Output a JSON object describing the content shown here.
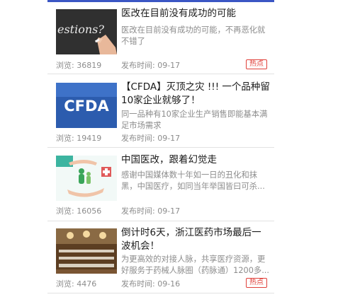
{
  "labels": {
    "views": "浏览: ",
    "published": "发布时间: "
  },
  "articles": [
    {
      "title": "医改在目前没有成功的可能",
      "summary": "医改在目前没有成功的可能，不再恶化就不错了",
      "views": "36819",
      "date": "09-17",
      "badge": "热点",
      "thumb_text": "estions?",
      "thumb_icon": "chalkboard-hand-image"
    },
    {
      "title": "【CFDA】灭顶之灾 !!! 一个品种留10家企业就够了！",
      "summary": "同一品种有10家企业生产销售即能基本满足市场需求",
      "views": "19419",
      "date": "09-17",
      "badge": "",
      "thumb_text": "CFDA",
      "thumb_icon": "cfda-logo-image"
    },
    {
      "title": "中国医改，跟着幻觉走",
      "summary": "感谢中国媒体数十年如一日的丑化和抹黑，中国医疗，如同当年举国皆曰可杀...",
      "views": "16056",
      "date": "09-17",
      "badge": "",
      "thumb_text": "",
      "thumb_icon": "family-care-image"
    },
    {
      "title": "倒计时6天，浙江医药市场最后一波机会！",
      "summary": "为更高效的对接人脉，共享医疗资源，更好服务于药械人脉圈（药脉通）1200多...",
      "views": "4476",
      "date": "09-16",
      "badge": "热点",
      "thumb_text": "",
      "thumb_icon": "conference-hall-image"
    }
  ],
  "colors": {
    "accent": "#3b56c4",
    "badge": "#e0403a",
    "meta": "#8c8c8c"
  }
}
